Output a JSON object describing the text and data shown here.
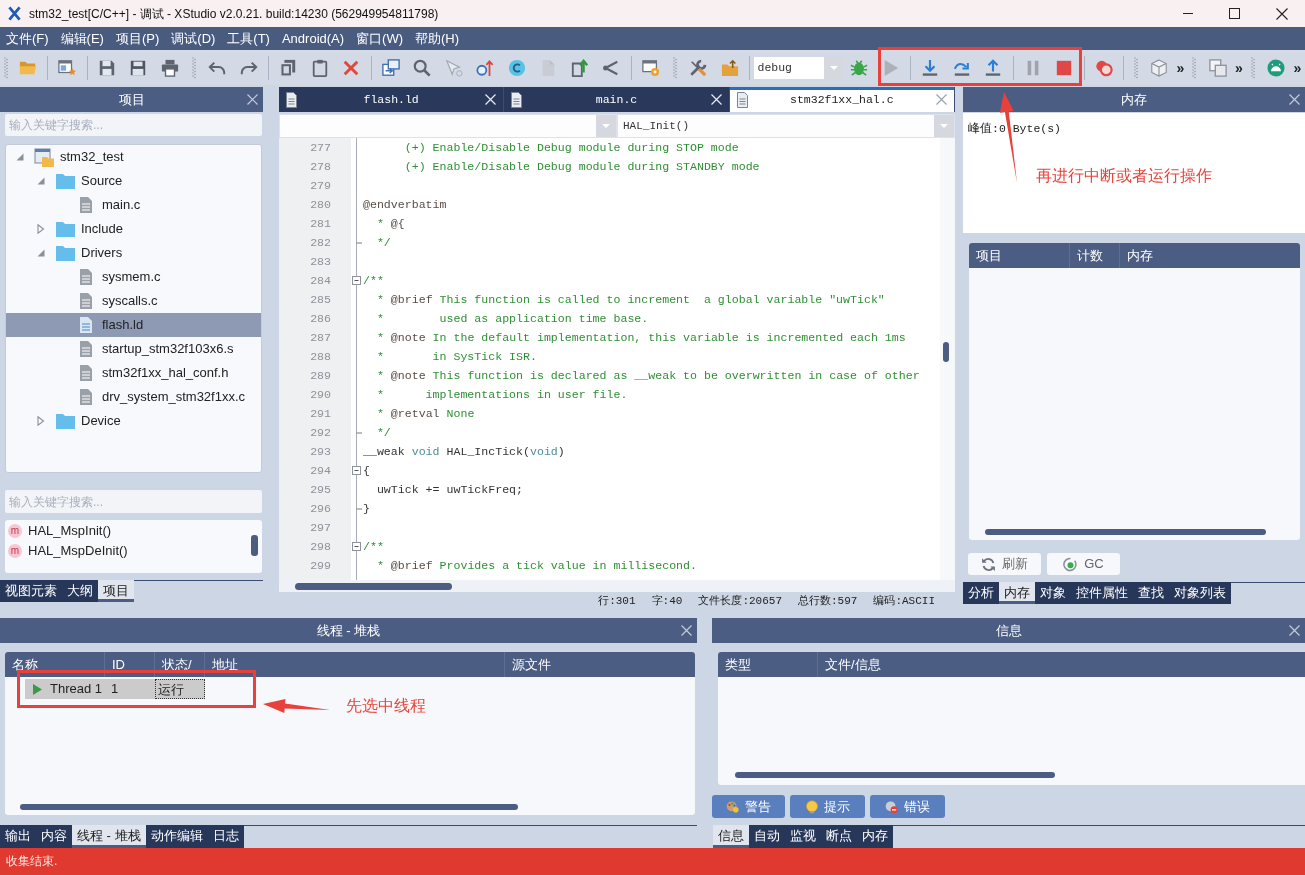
{
  "window": {
    "title": "stm32_test[C/C++] - 调试 - XStudio v2.0.21. build:14230 (562949954811798)"
  },
  "menu": [
    "文件(F)",
    "编辑(E)",
    "项目(P)",
    "调试(D)",
    "工具(T)",
    "Android(A)",
    "窗口(W)",
    "帮助(H)"
  ],
  "toolbar": {
    "buttons": [
      {
        "disabled": false
      },
      {
        "disabled": false
      },
      {
        "disabled": false
      },
      {
        "disabled": false
      },
      {
        "disabled": false
      },
      {
        "disabled": false
      },
      {
        "disabled": false
      },
      {
        "disabled": false
      },
      {
        "disabled": false
      },
      {
        "disabled": false
      },
      {
        "disabled": false
      },
      {
        "disabled": false
      },
      {
        "disabled": true
      },
      {
        "disabled": false
      },
      {
        "disabled": false
      },
      {
        "disabled": true
      },
      {
        "disabled": false
      },
      {
        "disabled": false
      },
      {
        "disabled": false
      },
      {
        "disabled": false
      },
      {
        "disabled": false
      },
      {
        "disabled": false
      },
      {
        "disabled": true
      },
      {
        "disabled": false
      },
      {
        "disabled": false
      },
      {
        "disabled": false
      },
      {
        "disabled": true
      },
      {
        "disabled": false
      },
      {
        "disabled": false
      },
      {
        "disabled": false
      },
      {
        "disabled": false
      },
      {
        "disabled": false
      }
    ],
    "build_config": "debug",
    "overflow": [
      "»",
      "»",
      "»"
    ]
  },
  "project_panel": {
    "title": "项目",
    "search": {
      "placeholder": "输入关键字搜索..."
    },
    "tree": [
      {
        "kind": "project",
        "label": "stm32_test",
        "expanded": true,
        "selected": false,
        "children": [
          {
            "kind": "folder",
            "label": "Source",
            "expanded": true,
            "selected": false,
            "children": [
              {
                "kind": "file",
                "label": "main.c",
                "selected": false
              }
            ]
          },
          {
            "kind": "folder",
            "label": "Include",
            "expanded": false,
            "selected": false
          },
          {
            "kind": "folder",
            "label": "Drivers",
            "expanded": true,
            "selected": false,
            "children": [
              {
                "kind": "file",
                "label": "sysmem.c",
                "selected": false
              },
              {
                "kind": "file",
                "label": "syscalls.c",
                "selected": false
              },
              {
                "kind": "file",
                "label": "flash.ld",
                "selected": true
              },
              {
                "kind": "file",
                "label": "startup_stm32f103x6.s",
                "selected": false
              },
              {
                "kind": "file",
                "label": "stm32f1xx_hal_conf.h",
                "selected": false
              },
              {
                "kind": "file",
                "label": "drv_system_stm32f1xx.c",
                "selected": false
              }
            ]
          },
          {
            "kind": "folder",
            "label": "Device",
            "expanded": false,
            "selected": false
          }
        ]
      }
    ]
  },
  "outline_panel": {
    "search": {
      "placeholder": "输入关键字搜索..."
    },
    "items": [
      {
        "badge": "m",
        "label": "HAL_MspInit()"
      },
      {
        "badge": "m",
        "label": "HAL_MspDeInit()"
      }
    ]
  },
  "left_tabs": [
    {
      "label": "视图元素",
      "selected": false
    },
    {
      "label": "大纲",
      "selected": false
    },
    {
      "label": "项目",
      "selected": true
    }
  ],
  "editor": {
    "tabs": [
      {
        "label": "flash.ld",
        "selected": false
      },
      {
        "label": "main.c",
        "selected": false
      },
      {
        "label": "stm32f1xx_hal.c",
        "selected": true
      }
    ],
    "function": "HAL_Init()",
    "lines": [
      {
        "number": "277",
        "kind": "line",
        "segments": [
          {
            "kind": "comment",
            "text": "      (+) Enable/Disable Debug module during STOP mode"
          }
        ]
      },
      {
        "number": "278",
        "kind": "line",
        "segments": [
          {
            "kind": "comment",
            "text": "      (+) Enable/Disable Debug module during STANDBY mode"
          }
        ]
      },
      {
        "number": "279",
        "kind": "line"
      },
      {
        "number": "280",
        "kind": "line",
        "segments": [
          {
            "kind": "tag",
            "text": "@endverbatim"
          }
        ]
      },
      {
        "number": "281",
        "kind": "line",
        "segments": [
          {
            "kind": "comment",
            "text": "  * "
          },
          {
            "kind": "tag",
            "text": "@{"
          }
        ]
      },
      {
        "number": "282",
        "kind": "fold_end",
        "segments": [
          {
            "kind": "comment",
            "text": "  */"
          }
        ]
      },
      {
        "number": "283",
        "kind": "line"
      },
      {
        "number": "284",
        "kind": "fold_start",
        "segments": [
          {
            "kind": "comment",
            "text": "/**"
          }
        ]
      },
      {
        "number": "285",
        "kind": "line",
        "segments": [
          {
            "kind": "comment",
            "text": "  * "
          },
          {
            "kind": "tag",
            "text": "@brief"
          },
          {
            "kind": "comment",
            "text": " This function is called to increment  a global variable \"uwTick\""
          }
        ]
      },
      {
        "number": "286",
        "kind": "line",
        "segments": [
          {
            "kind": "comment",
            "text": "  *        used as application time base."
          }
        ]
      },
      {
        "number": "287",
        "kind": "line",
        "segments": [
          {
            "kind": "comment",
            "text": "  * "
          },
          {
            "kind": "tag",
            "text": "@note"
          },
          {
            "kind": "comment",
            "text": " In the default implementation, this variable is incremented each 1ms"
          }
        ]
      },
      {
        "number": "288",
        "kind": "line",
        "segments": [
          {
            "kind": "comment",
            "text": "  *       in SysTick ISR."
          }
        ]
      },
      {
        "number": "289",
        "kind": "line",
        "segments": [
          {
            "kind": "comment",
            "text": "  * "
          },
          {
            "kind": "tag",
            "text": "@note"
          },
          {
            "kind": "comment",
            "text": " This function is declared as __weak to be overwritten in case of other"
          }
        ]
      },
      {
        "number": "290",
        "kind": "line",
        "segments": [
          {
            "kind": "comment",
            "text": "  *      implementations in user file."
          }
        ]
      },
      {
        "number": "291",
        "kind": "line",
        "segments": [
          {
            "kind": "comment",
            "text": "  * "
          },
          {
            "kind": "tag",
            "text": "@retval"
          },
          {
            "kind": "comment",
            "text": " None"
          }
        ]
      },
      {
        "number": "292",
        "kind": "fold_end",
        "segments": [
          {
            "kind": "comment",
            "text": "  */"
          }
        ]
      },
      {
        "number": "293",
        "kind": "line",
        "segments": [
          {
            "kind": "plain",
            "text": "__weak "
          },
          {
            "kind": "keyword",
            "text": "void"
          },
          {
            "kind": "plain",
            "text": " HAL_IncTick("
          },
          {
            "kind": "keyword",
            "text": "void"
          },
          {
            "kind": "plain",
            "text": ")"
          }
        ]
      },
      {
        "number": "294",
        "kind": "fold_start",
        "segments": [
          {
            "kind": "plain",
            "text": "{"
          }
        ]
      },
      {
        "number": "295",
        "kind": "line",
        "segments": [
          {
            "kind": "plain",
            "text": "  uwTick += uwTickFreq;"
          }
        ]
      },
      {
        "number": "296",
        "kind": "fold_end",
        "segments": [
          {
            "kind": "plain",
            "text": "}"
          }
        ]
      },
      {
        "number": "297",
        "kind": "line"
      },
      {
        "number": "298",
        "kind": "fold_start",
        "segments": [
          {
            "kind": "comment",
            "text": "/**"
          }
        ]
      },
      {
        "number": "299",
        "kind": "line",
        "segments": [
          {
            "kind": "comment",
            "text": "  * "
          },
          {
            "kind": "tag",
            "text": "@brief"
          },
          {
            "kind": "comment",
            "text": " Provides a tick value in millisecond."
          }
        ]
      }
    ],
    "status": [
      "行:301",
      "字:40",
      "文件长度:20657",
      "总行数:597",
      "编码:ASCII"
    ]
  },
  "memory_panel": {
    "title": "内存",
    "peak": "峰值:0 Byte(s)",
    "columns": [
      "项目",
      "计数",
      "内存"
    ],
    "buttons": [
      "刷新",
      "GC"
    ],
    "tabs": [
      {
        "label": "分析",
        "selected": false
      },
      {
        "label": "内存",
        "selected": true
      },
      {
        "label": "对象",
        "selected": false
      },
      {
        "label": "控件属性",
        "selected": false
      },
      {
        "label": "查找",
        "selected": false
      },
      {
        "label": "对象列表",
        "selected": false
      }
    ]
  },
  "thread_panel": {
    "title": "线程 - 堆栈",
    "columns": [
      "名称",
      "ID",
      "状态/",
      "地址",
      "源文件"
    ],
    "rows": [
      {
        "name": "Thread 1",
        "id": "1",
        "state": "运行",
        "selected": true
      }
    ],
    "tabs": [
      {
        "label": "输出",
        "selected": false
      },
      {
        "label": "内容",
        "selected": false
      },
      {
        "label": "线程 - 堆栈",
        "selected": true
      },
      {
        "label": "动作编辑",
        "selected": false
      },
      {
        "label": "日志",
        "selected": false
      }
    ]
  },
  "info_panel": {
    "title": "信息",
    "columns": [
      "类型",
      "文件/信息"
    ],
    "buttons": [
      "警告",
      "提示",
      "错误"
    ],
    "tabs": [
      {
        "label": "信息",
        "selected": true
      },
      {
        "label": "自动",
        "selected": false
      },
      {
        "label": "监视",
        "selected": false
      },
      {
        "label": "断点",
        "selected": false
      },
      {
        "label": "内存",
        "selected": false
      }
    ]
  },
  "status_bar": {
    "text": "收集结束."
  },
  "annotations": [
    {
      "text": "再进行中断或者运行操作"
    },
    {
      "text": "先选中线程"
    }
  ]
}
